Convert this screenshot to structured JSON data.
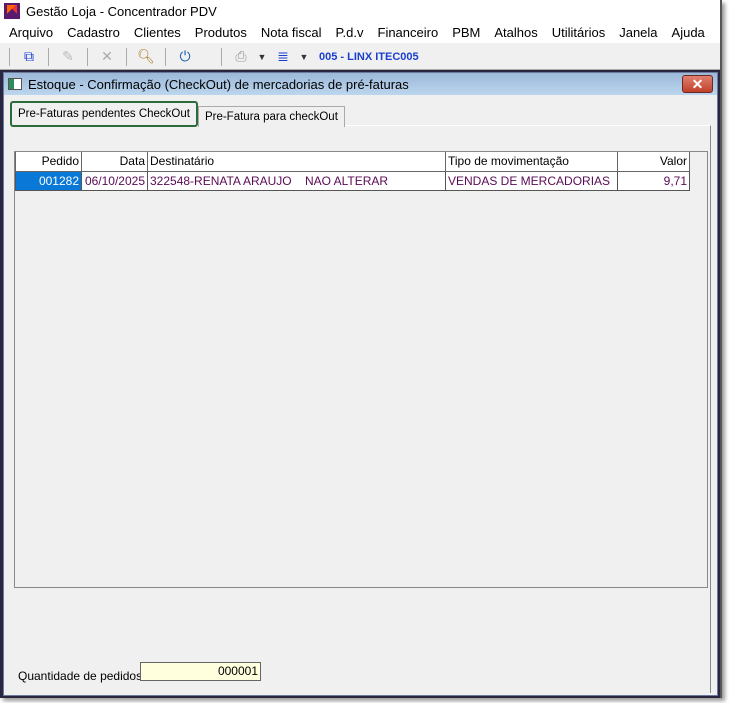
{
  "app": {
    "title": "Gestão Loja - Concentrador PDV"
  },
  "menu": [
    "Arquivo",
    "Cadastro",
    "Clientes",
    "Produtos",
    "Nota fiscal",
    "P.d.v",
    "Financeiro",
    "PBM",
    "Atalhos",
    "Utilitários",
    "Janela",
    "Ajuda"
  ],
  "toolbar": {
    "store_label": "005 - LINX ITEC005"
  },
  "window": {
    "title": "Estoque - Confirmação (CheckOut) de mercadorias de pré-faturas",
    "close": "✕"
  },
  "tabs": [
    {
      "label": "Pre-Faturas pendentes CheckOut"
    },
    {
      "label": "Pre-Fatura para checkOut"
    }
  ],
  "grid": {
    "columns": [
      "Pedido",
      "Data",
      "Destinatário",
      "Tipo de movimentação",
      "Valor"
    ],
    "rows": [
      [
        "001282",
        "06/10/2025",
        "322548-RENATA ARAUJO    NAO ALTERAR",
        "VENDAS DE MERCADORIAS",
        "9,71"
      ]
    ]
  },
  "summary": {
    "label": "Quantidade de pedidos.:",
    "value": "000001"
  }
}
